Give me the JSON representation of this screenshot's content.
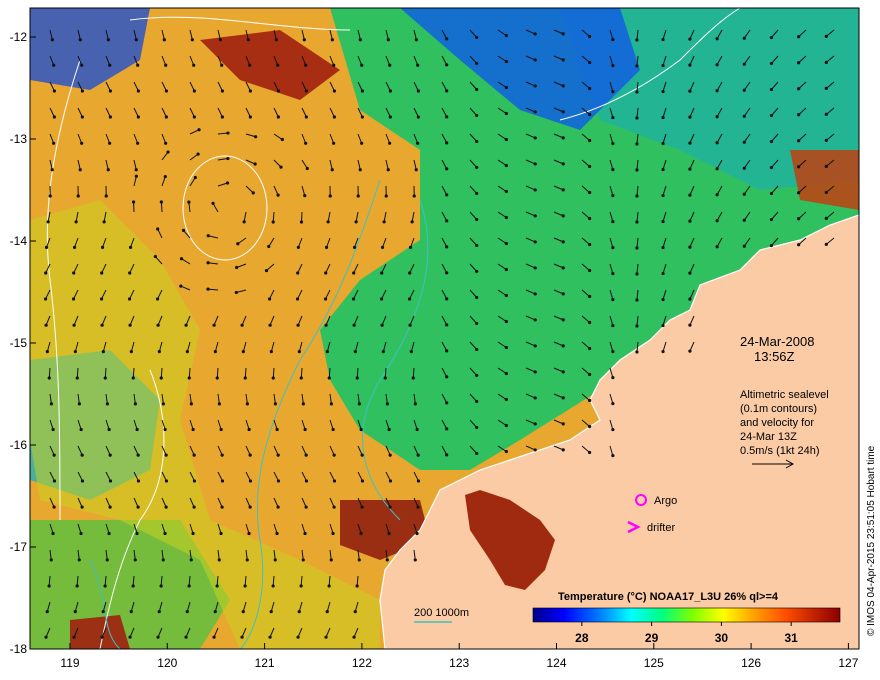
{
  "map": {
    "date": "24-Mar-2008",
    "time": "13:56Z",
    "legend_text": [
      "Altimetric sealevel",
      "(0.1m contours)",
      "and velocity for",
      "24-Mar 13Z",
      "0.5m/s (1kt 24h)"
    ],
    "argo_label": "Argo",
    "drifter_label": "drifter",
    "contour_scale_label": "200  1000m",
    "colorbar": {
      "title": "Temperature (°C) NOAA17_L3U 26% ql>=4",
      "ticks": [
        "28",
        "29",
        "30",
        "31"
      ],
      "tick_values": [
        28,
        29,
        30,
        31
      ],
      "range": [
        27.3,
        31.7
      ],
      "colors": [
        "#00008b",
        "#0000ff",
        "#0080ff",
        "#00ffff",
        "#00ff80",
        "#80ff00",
        "#ffff00",
        "#ffa000",
        "#ff5000",
        "#c02000",
        "#8b0000"
      ]
    },
    "credit": "© IMOS 04-Apr-2015 23:51:05 Hobart time",
    "lon_ticks": [
      "119",
      "120",
      "121",
      "122",
      "123",
      "124",
      "125",
      "126",
      "127"
    ],
    "lat_ticks": [
      "-12",
      "-13",
      "-14",
      "-15",
      "-16",
      "-17",
      "-18"
    ],
    "colors": {
      "land": "#fbcba6",
      "warm": "#f0a020",
      "hot": "#a02010",
      "cool": "#20c060",
      "cold": "#0040d0",
      "contour_white": "#ffffff",
      "isobath": "#40c0c0",
      "argo": "#ff00ff"
    }
  }
}
